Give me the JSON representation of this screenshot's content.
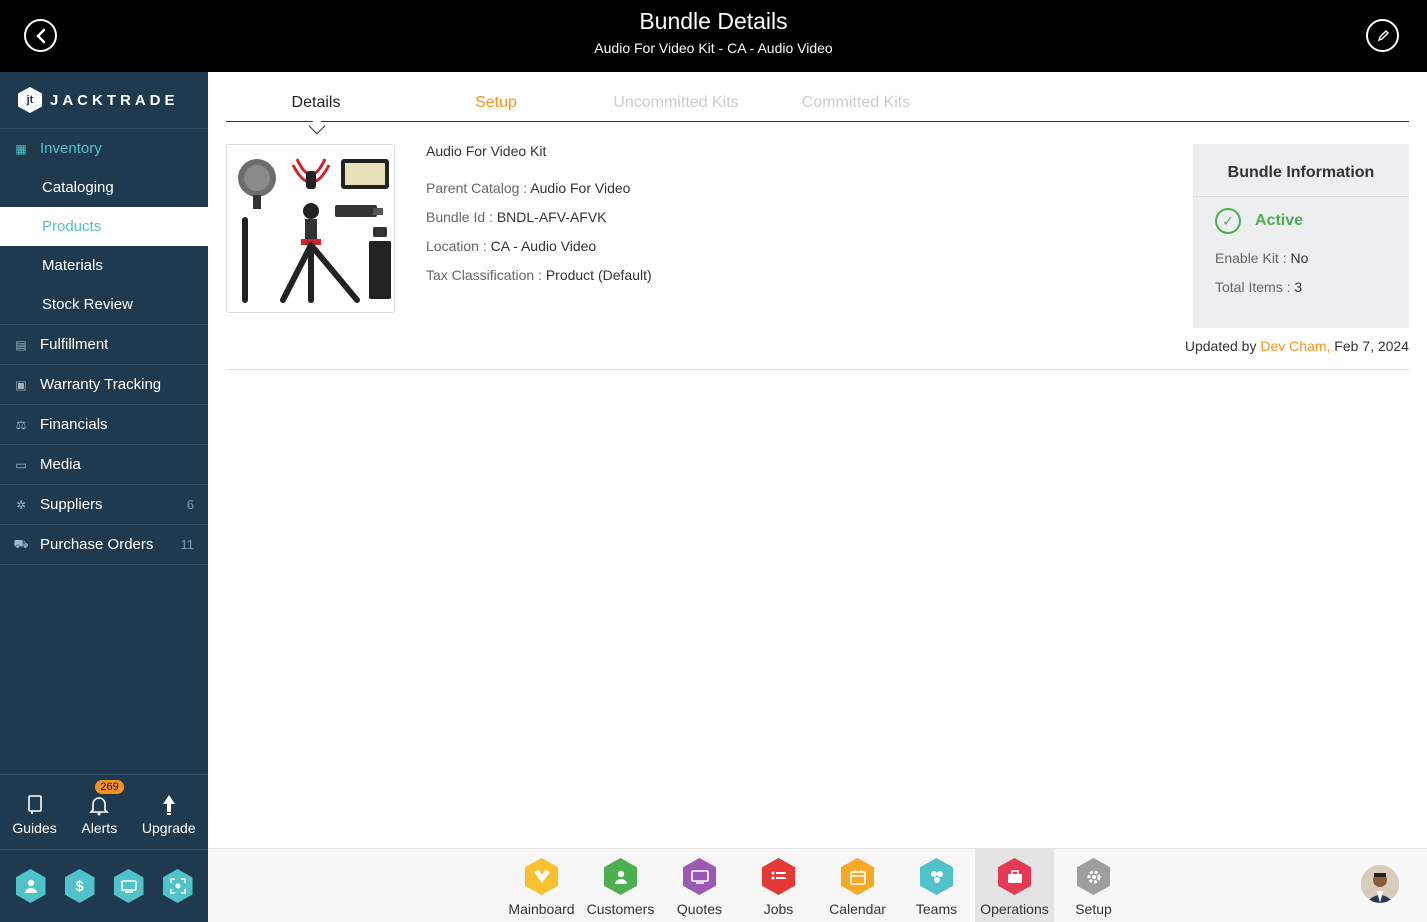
{
  "header": {
    "title": "Bundle Details",
    "subtitle": "Audio For Video Kit - CA - Audio Video"
  },
  "sidebar": {
    "brand": "JACKTRADE",
    "inventory": {
      "label": "Inventory",
      "subitems": [
        "Cataloging",
        "Products",
        "Materials",
        "Stock Review"
      ],
      "selected": "Products"
    },
    "items": [
      {
        "label": "Fulfillment",
        "icon": "fulfillment-icon"
      },
      {
        "label": "Warranty Tracking",
        "icon": "warranty-icon"
      },
      {
        "label": "Financials",
        "icon": "financials-icon"
      },
      {
        "label": "Media",
        "icon": "media-icon"
      },
      {
        "label": "Suppliers",
        "icon": "suppliers-icon",
        "count": "6"
      },
      {
        "label": "Purchase Orders",
        "icon": "purchase-orders-icon",
        "count": "11"
      }
    ],
    "bottom": {
      "guides": "Guides",
      "alerts": "Alerts",
      "alerts_badge": "269",
      "upgrade": "Upgrade"
    }
  },
  "tabs": [
    "Details",
    "Setup",
    "Uncommitted Kits",
    "Committed Kits"
  ],
  "product": {
    "name": "Audio For Video Kit",
    "parent_catalog_label": "Parent Catalog : ",
    "parent_catalog": "Audio For Video",
    "bundle_id_label": "Bundle Id : ",
    "bundle_id": "BNDL-AFV-AFVK",
    "location_label": "Location : ",
    "location": "CA - Audio Video",
    "tax_label": "Tax Classification : ",
    "tax": "Product (Default)"
  },
  "bundle_info": {
    "title": "Bundle Information",
    "status": "Active",
    "enable_kit_label": "Enable Kit : ",
    "enable_kit": "No",
    "total_items_label": "Total Items : ",
    "total_items": "3"
  },
  "updated": {
    "prefix": "Updated by ",
    "who": "Dev Cham,",
    "date": " Feb 7, 2024"
  },
  "apps": [
    {
      "label": "Mainboard",
      "color": "#f9c12e"
    },
    {
      "label": "Customers",
      "color": "#4caf50"
    },
    {
      "label": "Quotes",
      "color": "#9b59b6"
    },
    {
      "label": "Jobs",
      "color": "#e53935"
    },
    {
      "label": "Calendar",
      "color": "#f9a825"
    },
    {
      "label": "Teams",
      "color": "#4fc3c9"
    },
    {
      "label": "Operations",
      "color": "#e53955"
    },
    {
      "label": "Setup",
      "color": "#9e9e9e"
    }
  ],
  "colors": {
    "accent": "#4fc3c9",
    "orange": "#f7941d",
    "sidebar": "#1f3a4f",
    "active_green": "#4caf50"
  }
}
